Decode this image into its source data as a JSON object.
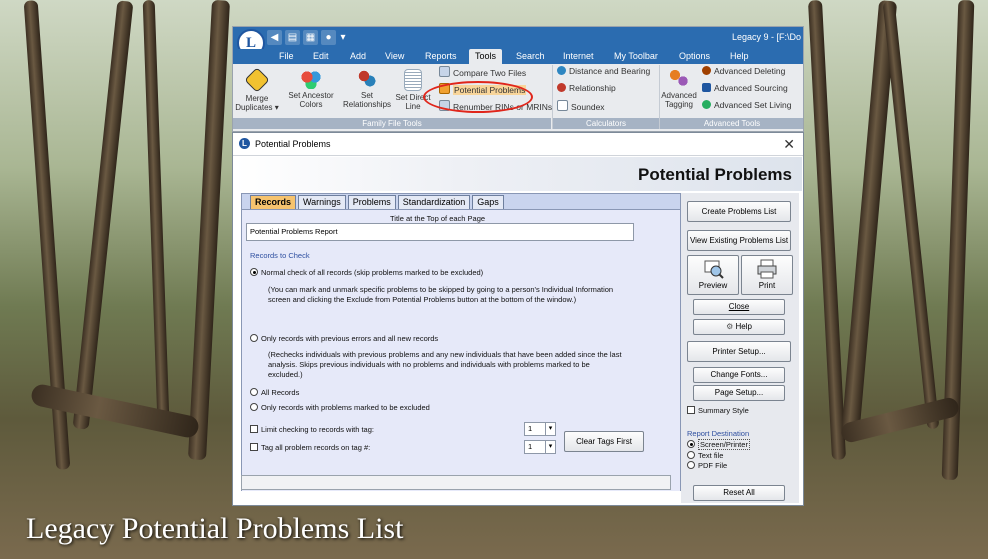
{
  "caption": "Legacy Potential Problems List",
  "app": {
    "window_title": "Legacy 9 - [F:\\Do",
    "logo_letter": "L",
    "menus": [
      "File",
      "Edit",
      "Add",
      "View",
      "Reports",
      "Tools",
      "Search",
      "Internet",
      "My Toolbar",
      "Options",
      "Help"
    ],
    "active_menu": "Tools"
  },
  "ribbon": {
    "family_file_tools": {
      "label": "Family File Tools",
      "merge": "Merge\nDuplicates ▾",
      "merge_l1": "Merge",
      "merge_l2": "Duplicates ▾",
      "ancestor_l1": "Set Ancestor",
      "ancestor_l2": "Colors",
      "relationships_l1": "Set",
      "relationships_l2": "Relationships",
      "direct_l1": "Set Direct",
      "direct_l2": "Line",
      "compare": "Compare Two Files",
      "potential": "Potential Problems",
      "renumber": "Renumber RINs or MRINs"
    },
    "calculators": {
      "label": "Calculators",
      "distance": "Distance and Bearing",
      "relationship": "Relationship",
      "soundex": "Soundex"
    },
    "advanced_tools": {
      "label": "Advanced Tools",
      "tagging_l1": "Advanced",
      "tagging_l2": "Tagging",
      "deleting": "Advanced Deleting",
      "sourcing": "Advanced Sourcing",
      "set_living": "Advanced Set Living"
    }
  },
  "dialog": {
    "title": "Potential Problems",
    "header": "Potential Problems",
    "tabs": [
      "Records",
      "Warnings",
      "Problems",
      "Standardization",
      "Gaps"
    ],
    "active_tab": "Records",
    "title_label": "Title at the Top of each Page",
    "title_value": "Potential Problems Report",
    "records_to_check": "Records to Check",
    "opt_normal": "Normal check of all records (skip problems marked to be excluded)",
    "opt_normal_desc_1": "(You can mark and unmark specific problems to be skipped by going to a person's Individual Information",
    "opt_normal_desc_2": "screen and clicking the Exclude from Potential Problems button at the bottom of the window.)",
    "opt_previous": "Only records with previous errors and all new records",
    "opt_previous_desc_1": "(Rechecks individuals with previous problems and any new individuals that have been added since the last",
    "opt_previous_desc_2": "analysis.  Skips previous individuals with no problems and individuals with problems marked to be",
    "opt_previous_desc_3": "excluded.)",
    "opt_all": "All Records",
    "opt_excluded": "Only records with problems marked to be excluded",
    "limit_tag": "Limit checking to records with tag:",
    "tag_all": "Tag all problem records on tag #:",
    "limit_tag_value": "1",
    "tag_all_value": "1",
    "clear_tags": "Clear Tags First",
    "side": {
      "create": "Create Problems List",
      "view": "View Existing Problems List",
      "preview": "Preview",
      "print": "Print",
      "close": "Close",
      "help": "Help",
      "printer_setup": "Printer Setup...",
      "change_fonts": "Change Fonts...",
      "page_setup": "Page Setup...",
      "summary_style": "Summary Style",
      "report_destination": "Report Destination",
      "dest_screen": "Screen/Printer",
      "dest_text": "Text file",
      "dest_pdf": "PDF File",
      "reset_all": "Reset All"
    }
  },
  "colors": {
    "ribbon_blue": "#2b6cb0",
    "tab_active": "#f6c36e",
    "panel_bg": "#e6e9f9",
    "highlight_ring": "#e0261b"
  }
}
